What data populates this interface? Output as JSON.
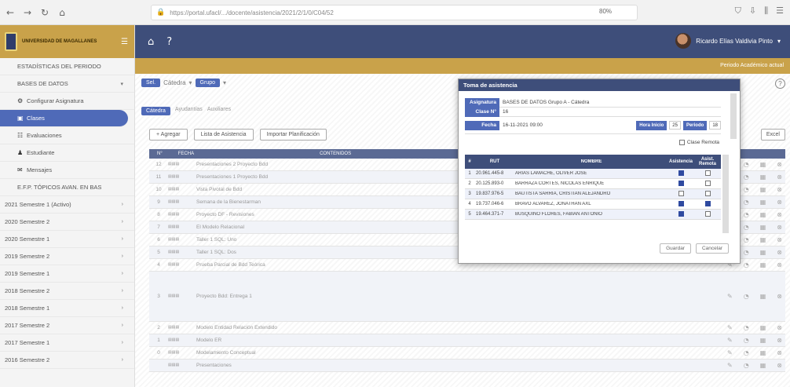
{
  "browser": {
    "url": "https://portal.ufacl/.../docente/asistencia/2021/2/1/0/C04/52",
    "zoom": "80%"
  },
  "app": {
    "logo_text": "UNIVERSIDAD DE MAGALLANES",
    "user_name": "Ricardo Elías Valdivia Pinto",
    "sub_header": "Periodo Académico actual"
  },
  "sidebar": {
    "items": [
      {
        "label": "ESTADÍSTICAS DEL PERIODO"
      },
      {
        "label": "BASES DE DATOS"
      },
      {
        "label": "Configurar Asignatura"
      },
      {
        "label": "Clases"
      },
      {
        "label": "Evaluaciones"
      },
      {
        "label": "Estudiante"
      },
      {
        "label": "Mensajes"
      },
      {
        "label": "E.F.P. TÓPICOS AVAN. EN BAS"
      }
    ],
    "semesters": [
      "2021 Semestre 1 (Activo)",
      "2020 Semestre 2",
      "2020 Semestre 1",
      "2019 Semestre 2",
      "2019 Semestre 1",
      "2018 Semestre 2",
      "2018 Semestre 1",
      "2017 Semestre 2",
      "2017 Semestre 1",
      "2016 Semestre 2"
    ]
  },
  "main": {
    "section_pill": "Sel.",
    "section_label": "Cátedra",
    "group_pill": "Grupo",
    "subtabs": [
      "Cátedra",
      "Ayudantías",
      "Auxiliares"
    ],
    "buttons": {
      "add": "+ Agregar",
      "attendance_list": "Lista de Asistencia",
      "import": "Importar Planificación",
      "excel": "Excel"
    },
    "table_head": [
      "N°",
      "FECHA",
      "CONTENIDOS"
    ],
    "rows": [
      {
        "n": "12",
        "name": "Presentaciones 2 Proyecto Bdd"
      },
      {
        "n": "11",
        "name": "Presentaciones 1 Proyecto Bdd"
      },
      {
        "n": "10",
        "name": "Vista Pivotal de Bdd"
      },
      {
        "n": "9",
        "name": "Semana de la Bienestarman"
      },
      {
        "n": "8",
        "name": "Proyecto DF - Revisiones"
      },
      {
        "n": "7",
        "name": "El Modelo Relacional"
      },
      {
        "n": "6",
        "name": "Taller 1 SQL: Uno"
      },
      {
        "n": "5",
        "name": "Taller 1 SQL: Dos"
      },
      {
        "n": "4",
        "name": "Prueba Parcial de Bdd Teórica"
      },
      {
        "n": "3",
        "name": "Proyecto Bdd: Entrega 1"
      },
      {
        "n": "2",
        "name": "Modelo Entidad Relación Extendido"
      },
      {
        "n": "1",
        "name": "Modelo ER"
      },
      {
        "n": "0",
        "name": "Modelamiento Conceptual"
      },
      {
        "n": "",
        "name": "Presentaciones"
      }
    ]
  },
  "modal": {
    "title": "Toma de asistencia",
    "asignatura_label": "Asignatura",
    "asignatura_value": "BASES DE DATOS Grupo A - Cátedra",
    "clase_label": "Clase N°",
    "clase_value": "16",
    "fecha_label": "Fecha",
    "fecha_value": "16-11-2021 09:00",
    "hora_label": "Hora Inicio",
    "hora_value": "25",
    "periodo_label": "Periodo",
    "periodo_value": "18",
    "remote_label": "Clase Remota",
    "columns": [
      "#",
      "RUT",
      "NOMBRE",
      "Asistencia",
      "Asist. Remota"
    ],
    "students": [
      {
        "n": "1",
        "rut": "20.961.445-8",
        "name": "ARIAS LAMACHE, OLIVER JOSÉ",
        "asist": true,
        "remota": false
      },
      {
        "n": "2",
        "rut": "20.125.893-0",
        "name": "BARRAZA CORTÉS, NICOLÁS ENRIQUE",
        "asist": true,
        "remota": false
      },
      {
        "n": "3",
        "rut": "19.837.976-5",
        "name": "BAUTISTA SARRÍA, CRISTIÁN ALEJANDRO",
        "asist": false,
        "remota": false
      },
      {
        "n": "4",
        "rut": "19.737.046-6",
        "name": "BRAVO ÁLVAREZ, JONATHAN AXL",
        "asist": true,
        "remota": true
      },
      {
        "n": "5",
        "rut": "19.464.371-7",
        "name": "BUSQUIÑO FLORES, FABIÁN ANTONIO",
        "asist": true,
        "remota": false
      }
    ],
    "save": "Guardar",
    "cancel": "Cancelar"
  }
}
